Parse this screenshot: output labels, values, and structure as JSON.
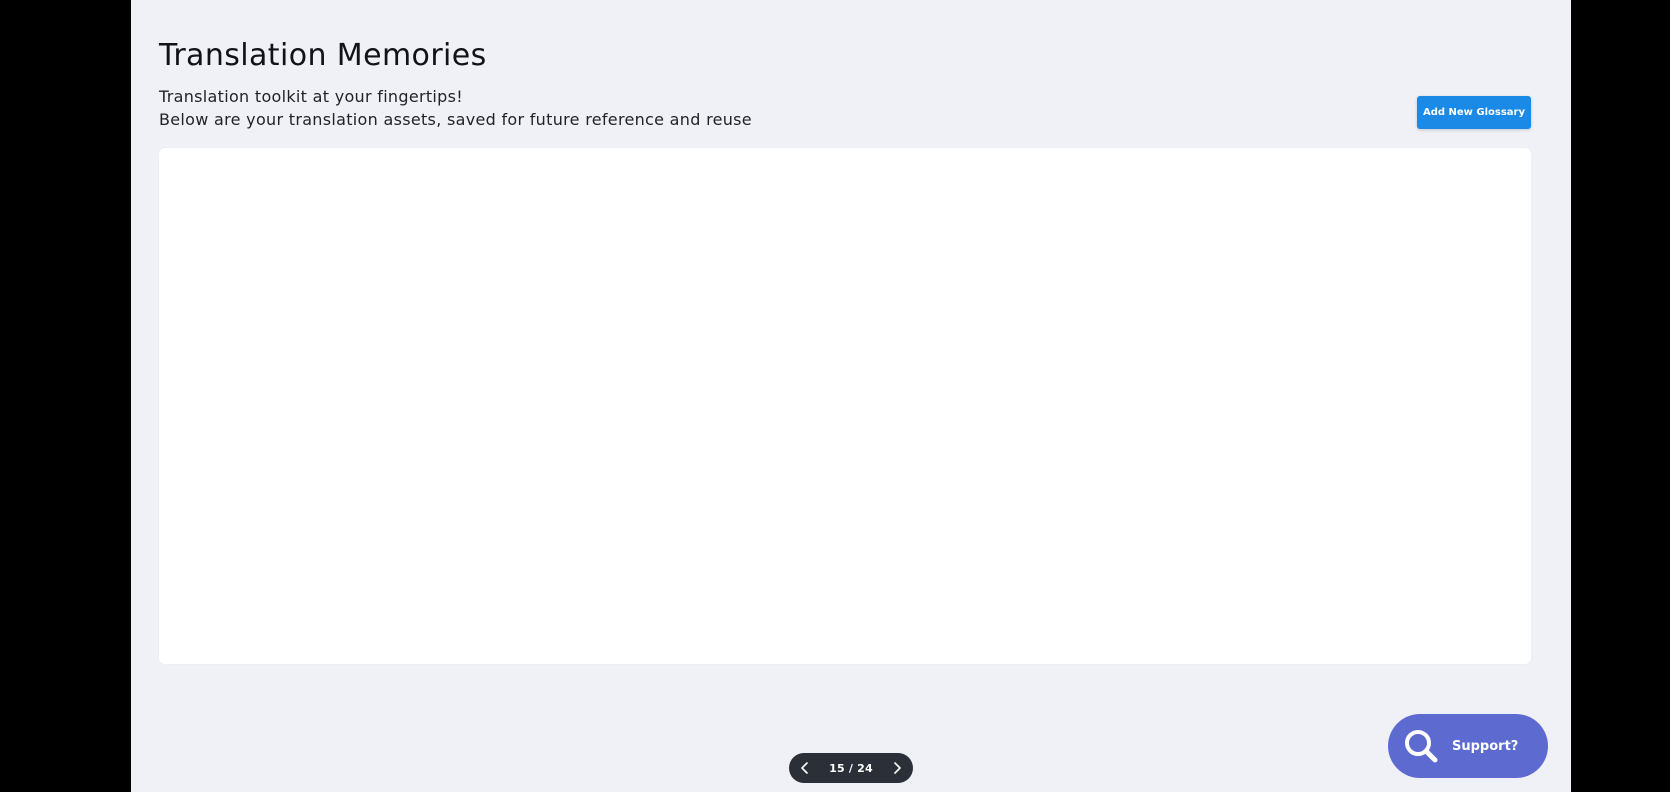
{
  "header": {
    "title": "Translation Memories",
    "subtitle_line1": "Translation toolkit at your fingertips!",
    "subtitle_line2": "Below are your translation assets, saved for future reference and reuse",
    "add_button_label": "Add New Glossary"
  },
  "pagination": {
    "text": "15 / 24",
    "prev_icon": "chevron-left-icon",
    "next_icon": "chevron-right-icon"
  },
  "support": {
    "label": "Support?",
    "icon": "search-icon"
  },
  "colors": {
    "page_background": "#f0f1f6",
    "panel_background": "#ffffff",
    "primary_button": "#1a8ae6",
    "pager_background": "#2b3038",
    "support_background": "#5d6bd0"
  }
}
